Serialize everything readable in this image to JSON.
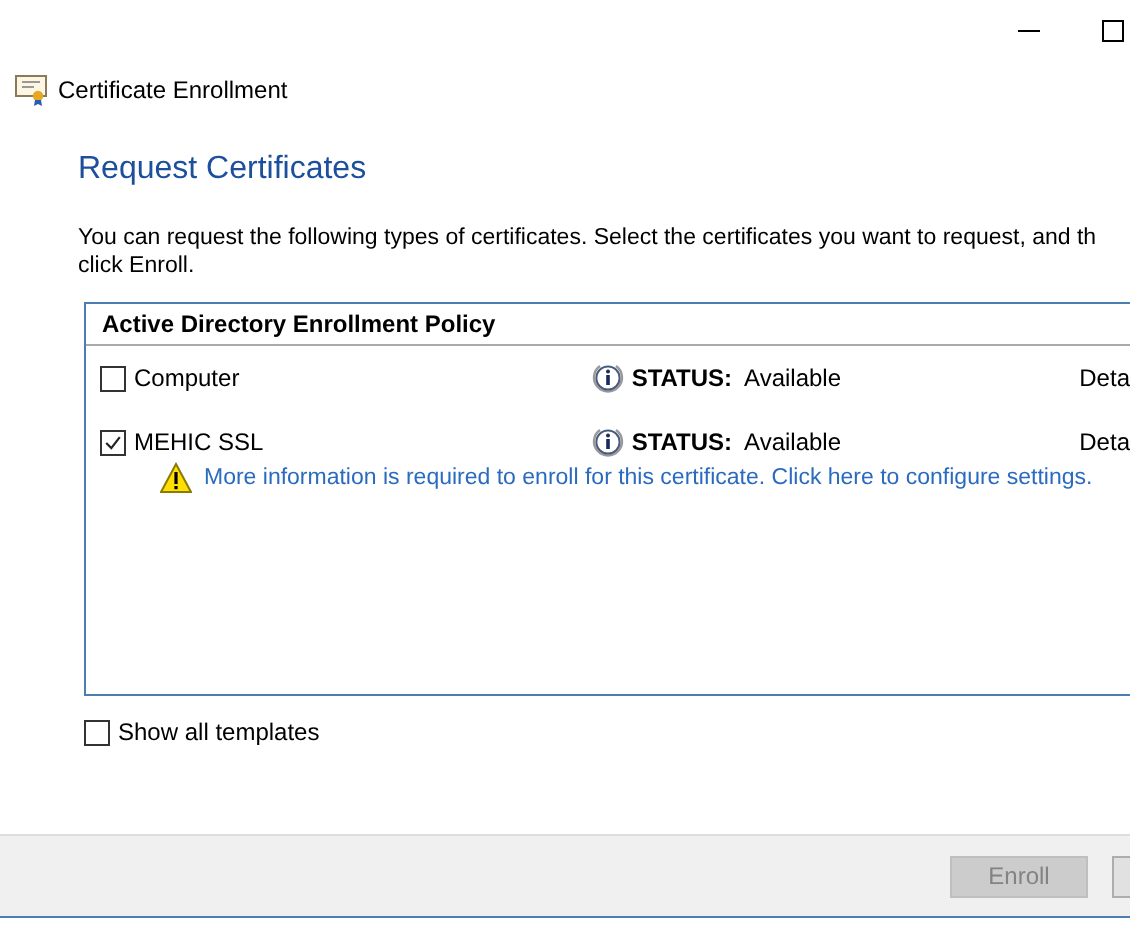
{
  "window": {
    "title": "Certificate Enrollment"
  },
  "heading": "Request Certificates",
  "intro": [
    "You can request the following types of certificates. Select the certificates you want to request, and th",
    "click Enroll."
  ],
  "policy": {
    "title": "Active Directory Enrollment Policy",
    "items": [
      {
        "name": "Computer",
        "checked": false,
        "status_label": "STATUS:",
        "status": "Available",
        "details": "Deta"
      },
      {
        "name": "MEHIC SSL",
        "checked": true,
        "status_label": "STATUS:",
        "status": "Available",
        "details": "Deta",
        "warning": "More information is required to enroll for this certificate. Click here to configure settings."
      }
    ]
  },
  "show_all": {
    "label": "Show all templates",
    "checked": false
  },
  "buttons": [
    {
      "label": "Enroll",
      "disabled": true
    },
    {
      "disabled": false
    }
  ]
}
